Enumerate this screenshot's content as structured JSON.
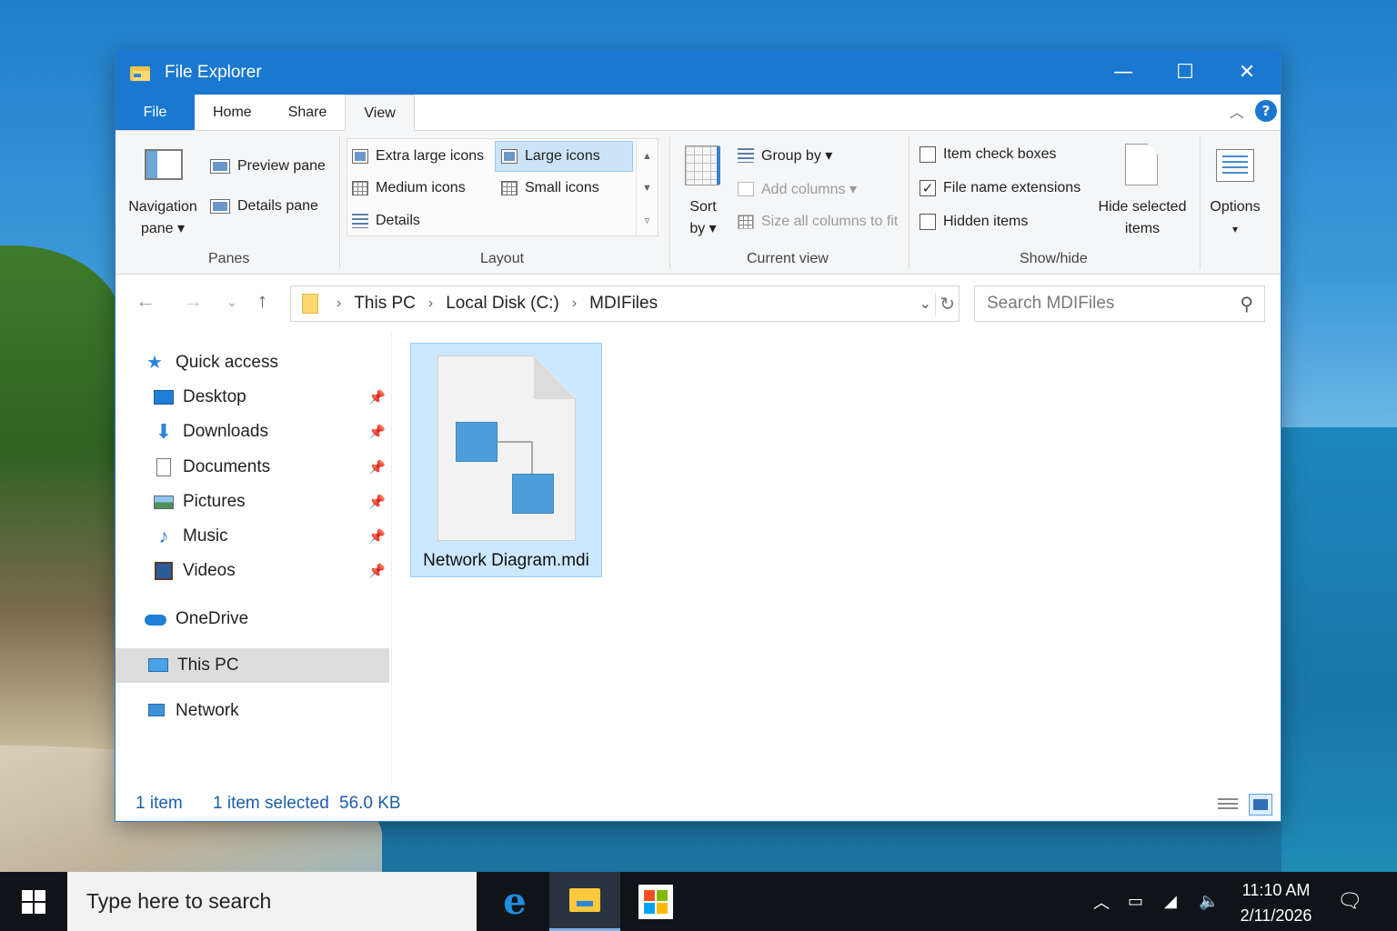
{
  "window": {
    "title": "File Explorer",
    "controls": {
      "minimize": "—",
      "maximize": "☐",
      "close": "✕"
    }
  },
  "tabs": [
    "File",
    "Home",
    "Share",
    "View"
  ],
  "active_tab": "View",
  "help_label": "?",
  "ribbon": {
    "panes": {
      "navigation_pane_line1": "Navigation",
      "navigation_pane_line2": "pane ▾",
      "preview_pane": "Preview pane",
      "details_pane": "Details pane",
      "group_label": "Panes"
    },
    "layout": {
      "options": [
        "Extra large icons",
        "Large icons",
        "Medium icons",
        "Small icons",
        "Details"
      ],
      "selected": "Large icons",
      "group_label": "Layout"
    },
    "current_view": {
      "sort_line1": "Sort",
      "sort_line2": "by ▾",
      "group_by": "Group by ▾",
      "add_columns": "Add columns ▾",
      "size_columns": "Size all columns to fit",
      "group_label": "Current view"
    },
    "show_hide": {
      "item_check_boxes": {
        "label": "Item check boxes",
        "checked": false
      },
      "file_name_extensions": {
        "label": "File name extensions",
        "checked": true
      },
      "hidden_items": {
        "label": "Hidden items",
        "checked": false
      },
      "hide_selected_line1": "Hide selected",
      "hide_selected_line2": "items",
      "group_label": "Show/hide"
    },
    "options": {
      "label": "Options",
      "caret": "▾"
    }
  },
  "address": {
    "crumbs": [
      "This PC",
      "Local Disk (C:)",
      "MDIFiles"
    ],
    "search_placeholder": "Search MDIFiles"
  },
  "nav": {
    "quick_access": "Quick access",
    "pinned": [
      "Desktop",
      "Downloads",
      "Documents",
      "Pictures",
      "Music",
      "Videos"
    ],
    "onedrive": "OneDrive",
    "this_pc": "This PC",
    "network": "Network",
    "selected": "This PC"
  },
  "files": [
    {
      "name": "Network Diagram.mdi",
      "selected": true
    }
  ],
  "status": {
    "count": "1 item",
    "selection": "1 item selected",
    "size": "56.0 KB"
  },
  "taskbar": {
    "search_placeholder": "Type here to search",
    "time": "11:10 AM",
    "date": "2/11/2026"
  },
  "colors": {
    "accent": "#1a78d0",
    "selection": "#cce8ff",
    "diagram_node": "#4c9ed9"
  }
}
